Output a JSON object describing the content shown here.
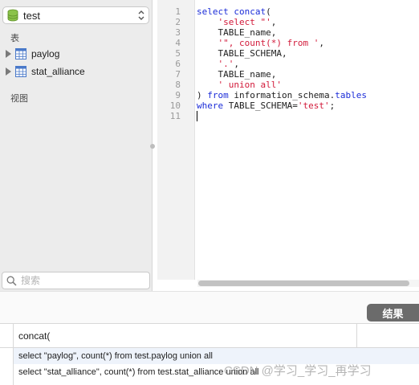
{
  "sidebar": {
    "database": "test",
    "section_tables": "表",
    "tables": [
      {
        "label": "paylog"
      },
      {
        "label": "stat_alliance"
      }
    ],
    "section_views": "视图",
    "search_placeholder": "搜索"
  },
  "editor": {
    "line_numbers": [
      "1",
      "2",
      "3",
      "4",
      "5",
      "6",
      "7",
      "8",
      "9",
      "10",
      "11"
    ]
  },
  "results": {
    "tab_label": "结果",
    "column_header": "concat(",
    "rows": [
      "select \"paylog\", count(*) from test.paylog union all",
      "select \"stat_alliance\", count(*) from test.stat_alliance union all"
    ]
  },
  "watermark": "CSDN @学习_学习_再学习",
  "colors": {
    "keyword": "#1b2cd8",
    "string": "#d21a3a",
    "results_tab": "#6b6b6b"
  },
  "icons": {
    "database": "database-icon",
    "table": "table-icon",
    "search": "search-icon"
  }
}
